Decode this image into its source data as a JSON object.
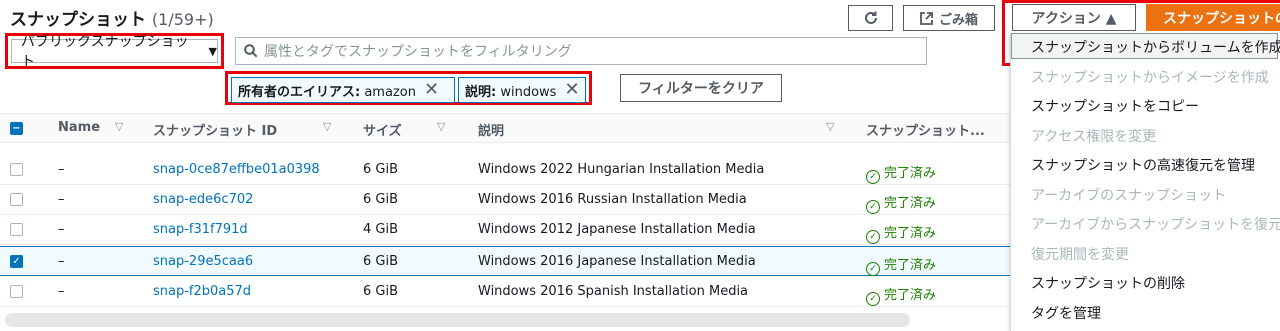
{
  "header": {
    "title": "スナップショット",
    "count": "(1/59+)"
  },
  "toolbar": {
    "refresh_icon": "refresh-icon",
    "recycle_bin_label": "ごみ箱",
    "actions_label": "アクション ▲",
    "create_snapshot_label": "スナップショットの作成"
  },
  "filter": {
    "scope_value": "パブリックスナップショット",
    "search_placeholder": "属性とタグでスナップショットをフィルタリング",
    "tokens": [
      {
        "key": "所有者のエイリアス:",
        "value": "amazon"
      },
      {
        "key": "説明:",
        "value": "windows"
      }
    ],
    "clear_label": "フィルターをクリア"
  },
  "table": {
    "columns": [
      "Name",
      "スナップショット ID",
      "サイズ",
      "説明",
      "スナップショット..."
    ],
    "rows": [
      {
        "name": "–",
        "id": "snap-0ce87effbe01a0398",
        "size": "6 GiB",
        "desc": "Windows 2022 Hungarian Installation Media",
        "status": "完了済み",
        "selected": false
      },
      {
        "name": "–",
        "id": "snap-ede6c702",
        "size": "6 GiB",
        "desc": "Windows 2016 Russian Installation Media",
        "status": "完了済み",
        "selected": false
      },
      {
        "name": "–",
        "id": "snap-f31f791d",
        "size": "4 GiB",
        "desc": "Windows 2012 Japanese Installation Media",
        "status": "完了済み",
        "selected": false
      },
      {
        "name": "–",
        "id": "snap-29e5caa6",
        "size": "6 GiB",
        "desc": "Windows 2016 Japanese Installation Media",
        "status": "完了済み",
        "selected": true
      },
      {
        "name": "–",
        "id": "snap-f2b0a57d",
        "size": "6 GiB",
        "desc": "Windows 2016 Spanish Installation Media",
        "status": "完了済み",
        "selected": false
      }
    ]
  },
  "actions_menu": {
    "items": [
      {
        "label": "スナップショットからボリュームを作成",
        "disabled": false
      },
      {
        "label": "スナップショットからイメージを作成",
        "disabled": true
      },
      {
        "label": "スナップショットをコピー",
        "disabled": false
      },
      {
        "label": "アクセス権限を変更",
        "disabled": true
      },
      {
        "label": "スナップショットの高速復元を管理",
        "disabled": false
      },
      {
        "label": "アーカイブのスナップショット",
        "disabled": true
      },
      {
        "label": "アーカイブからスナップショットを復元",
        "disabled": true
      },
      {
        "label": "復元期間を変更",
        "disabled": true
      },
      {
        "label": "スナップショットの削除",
        "disabled": false
      },
      {
        "label": "タグを管理",
        "disabled": false
      }
    ]
  },
  "colors": {
    "accent": "#0073bb",
    "primary_button": "#ec7211",
    "highlight": "#e8000b",
    "success": "#1d8102"
  }
}
